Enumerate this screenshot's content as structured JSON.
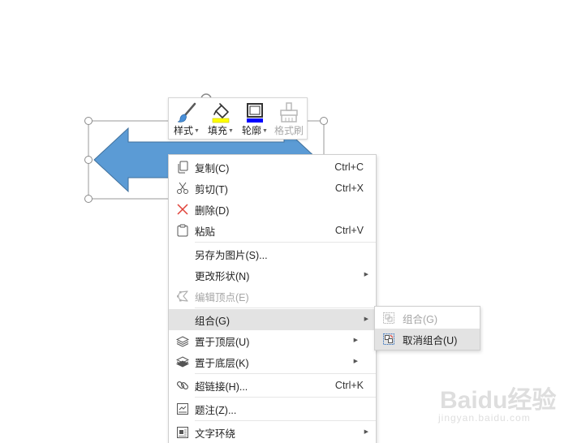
{
  "colors": {
    "shape_fill": "#5b9bd5",
    "shape_stroke": "#41719c",
    "menu_hover": "#e3e3e3",
    "fill_icon_accent": "#ffff00",
    "outline_icon_accent": "#0000ff"
  },
  "mini_toolbar": {
    "buttons": [
      {
        "label": "样式",
        "icon": "paintbrush-icon",
        "has_dropdown": true,
        "enabled": true
      },
      {
        "label": "填充",
        "icon": "paint-bucket-icon",
        "has_dropdown": true,
        "enabled": true
      },
      {
        "label": "轮廓",
        "icon": "shape-outline-icon",
        "has_dropdown": true,
        "enabled": true
      },
      {
        "label": "格式刷",
        "icon": "format-painter-icon",
        "has_dropdown": false,
        "enabled": false
      }
    ]
  },
  "context_menu": {
    "items": [
      {
        "label": "复制(C)",
        "shortcut": "Ctrl+C",
        "icon": "copy-icon",
        "enabled": true
      },
      {
        "label": "剪切(T)",
        "shortcut": "Ctrl+X",
        "icon": "scissors-icon",
        "enabled": true
      },
      {
        "label": "删除(D)",
        "shortcut": "",
        "icon": "delete-x-icon",
        "enabled": true
      },
      {
        "label": "粘贴",
        "shortcut": "Ctrl+V",
        "icon": "paste-icon",
        "enabled": true
      },
      {
        "label": "另存为图片(S)...",
        "shortcut": "",
        "icon": "",
        "enabled": true
      },
      {
        "label": "更改形状(N)",
        "shortcut": "",
        "icon": "",
        "enabled": true,
        "submenu": true
      },
      {
        "label": "编辑顶点(E)",
        "shortcut": "",
        "icon": "edit-points-icon",
        "enabled": false
      },
      {
        "label": "组合(G)",
        "shortcut": "",
        "icon": "",
        "enabled": true,
        "submenu": true,
        "highlighted": true
      },
      {
        "label": "置于顶层(U)",
        "shortcut": "",
        "icon": "bring-to-front-icon",
        "enabled": true,
        "submenu": true
      },
      {
        "label": "置于底层(K)",
        "shortcut": "",
        "icon": "send-to-back-icon",
        "enabled": true,
        "submenu": true
      },
      {
        "label": "超链接(H)...",
        "shortcut": "Ctrl+K",
        "icon": "hyperlink-icon",
        "enabled": true
      },
      {
        "label": "题注(Z)...",
        "shortcut": "",
        "icon": "caption-icon",
        "enabled": true
      },
      {
        "label": "文字环绕",
        "shortcut": "",
        "icon": "text-wrap-icon",
        "enabled": true,
        "submenu": true
      }
    ]
  },
  "sub_menu": {
    "items": [
      {
        "label": "组合(G)",
        "icon": "group-icon",
        "enabled": false
      },
      {
        "label": "取消组合(U)",
        "icon": "ungroup-icon",
        "enabled": true,
        "highlighted": true
      }
    ]
  },
  "watermark": {
    "text": "Baidu经验",
    "sub": "jingyan.baidu.com"
  }
}
